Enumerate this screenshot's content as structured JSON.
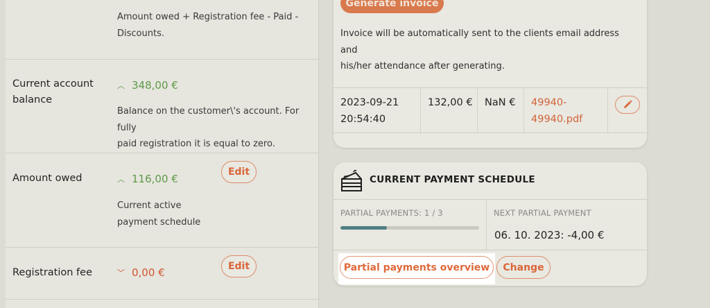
{
  "balance_rows": {
    "top_desc_line1": "Amount owed + Registration fee - Paid -",
    "top_desc_line2": "Discounts.",
    "current_balance": {
      "label_line1": "Current account",
      "label_line2": "balance",
      "value": "348,00 €",
      "desc_line1": "Balance on the customer\\'s account. For fully",
      "desc_line2": "paid registration it is equal to zero."
    },
    "amount_owed": {
      "label": "Amount owed",
      "value": "116,00 €",
      "edit_label": "Edit",
      "desc_line1": "Current active",
      "desc_line2": "payment schedule"
    },
    "registration_fee": {
      "label": "Registration fee",
      "value": "0,00 €",
      "edit_label": "Edit"
    }
  },
  "invoice": {
    "generate_label": "Generate invoice",
    "info_line1": "Invoice will be automatically sent to the clients email address and",
    "info_line2": "his/her attendance after generating.",
    "row": {
      "date": "2023-09-21",
      "time": "20:54:40",
      "amount": "132,00 €",
      "nan": "NaN €",
      "file_line1": "49940-",
      "file_line2": "49940.pdf"
    }
  },
  "payment_schedule": {
    "title": "CURRENT PAYMENT SCHEDULE",
    "partial_label": "PARTIAL PAYMENTS: 1 / 3",
    "progress_fraction": 0.333,
    "next_label": "NEXT PARTIAL PAYMENT",
    "next_value": "06. 10. 2023: -4,00 €",
    "overview_label": "Partial payments overview",
    "change_label": "Change"
  },
  "icons": {
    "up": "chevron-up-icon",
    "down": "chevron-down-icon",
    "pencil": "pencil-icon",
    "cake": "cake-icon"
  },
  "colors": {
    "accent": "#d87a4d",
    "positive": "#5d9a47",
    "negative": "#d2552f",
    "progress": "#4f7f82"
  }
}
